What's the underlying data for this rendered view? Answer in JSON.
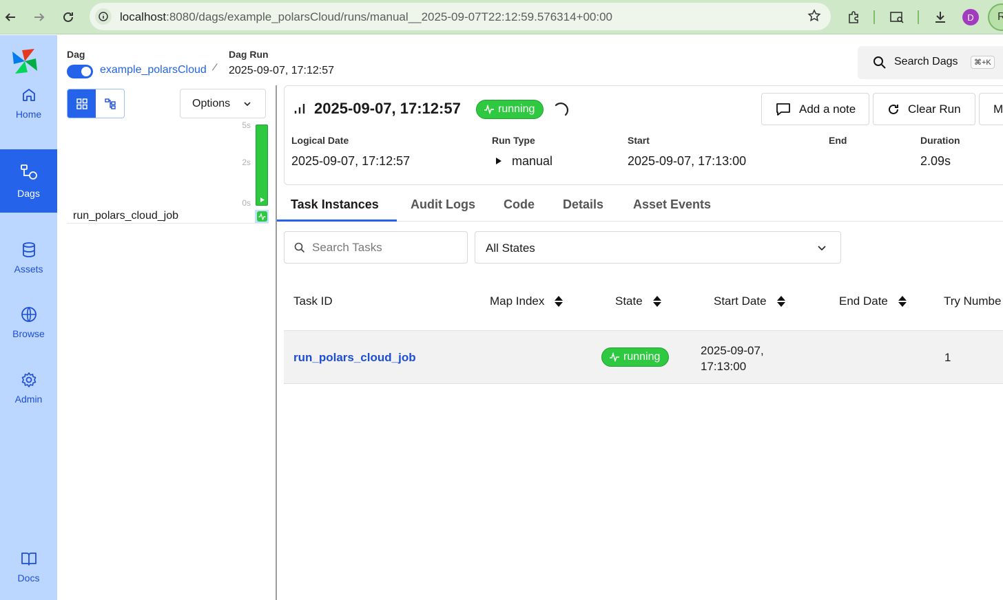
{
  "browser": {
    "url_host": "localhost",
    "url_path": ":8080/dags/example_polarsCloud/runs/manual__2025-09-07T22:12:59.576314+00:00",
    "profile_initial": "D",
    "profile2_initial": "R"
  },
  "sidebar": {
    "items": [
      {
        "label": "Home",
        "icon": "home-icon"
      },
      {
        "label": "Dags",
        "icon": "dags-icon",
        "active": true
      },
      {
        "label": "Assets",
        "icon": "database-icon"
      },
      {
        "label": "Browse",
        "icon": "globe-icon"
      },
      {
        "label": "Admin",
        "icon": "gear-icon"
      },
      {
        "label": "Docs",
        "icon": "book-icon"
      }
    ]
  },
  "breadcrumb": {
    "dag_label": "Dag",
    "dag_name": "example_polarsCloud",
    "run_label": "Dag Run",
    "run_value": "2025-09-07, 17:12:57"
  },
  "search_dags": {
    "label": "Search Dags",
    "shortcut": "⌘+K"
  },
  "grid": {
    "options_label": "Options",
    "axis": [
      "5s",
      "2s",
      "0s"
    ],
    "task_name": "run_polars_cloud_job"
  },
  "run": {
    "title": "2025-09-07, 17:12:57",
    "state": "running",
    "actions": [
      "Add a note",
      "Clear Run",
      "M"
    ],
    "meta": [
      {
        "label": "Logical Date",
        "value": "2025-09-07, 17:12:57"
      },
      {
        "label": "Run Type",
        "value": "manual"
      },
      {
        "label": "Start",
        "value": "2025-09-07, 17:13:00"
      },
      {
        "label": "End",
        "value": ""
      },
      {
        "label": "Duration",
        "value": "2.09s"
      }
    ]
  },
  "tabs": [
    "Task Instances",
    "Audit Logs",
    "Code",
    "Details",
    "Asset Events"
  ],
  "filters": {
    "search_placeholder": "Search Tasks",
    "state_value": "All States"
  },
  "table": {
    "columns": [
      "Task ID",
      "Map Index",
      "State",
      "Start Date",
      "End Date",
      "Try Numbe"
    ],
    "rows": [
      {
        "task_id": "run_polars_cloud_job",
        "state": "running",
        "start_line1": "2025-09-07,",
        "start_line2": "17:13:00",
        "end_date": "",
        "try_number": "1"
      }
    ]
  },
  "colors": {
    "accent": "#2563eb",
    "running": "#2ec940",
    "sidebar": "#bcd7ff"
  }
}
